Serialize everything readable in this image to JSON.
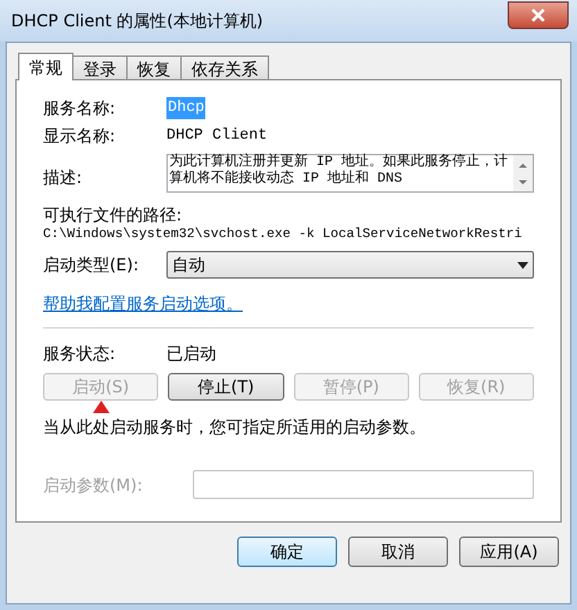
{
  "window": {
    "title": "DHCP Client 的属性(本地计算机)"
  },
  "tabs": [
    {
      "label": "常规",
      "selected": true
    },
    {
      "label": "登录",
      "selected": false
    },
    {
      "label": "恢复",
      "selected": false
    },
    {
      "label": "依存关系",
      "selected": false
    }
  ],
  "service_name": {
    "label": "服务名称:",
    "value": "Dhcp",
    "selected": true
  },
  "display_name": {
    "label": "显示名称:",
    "value": "DHCP Client"
  },
  "description": {
    "label": "描述:",
    "value": "为此计算机注册并更新 IP 地址。如果此服务停止，计算机将不能接收动态 IP 地址和 DNS"
  },
  "executable_path": {
    "label": "可执行文件的路径:",
    "value": "C:\\Windows\\system32\\svchost.exe -k LocalServiceNetworkRestri"
  },
  "startup_type": {
    "label": "启动类型(E):",
    "value": "自动"
  },
  "help_link": "帮助我配置服务启动选项。",
  "service_status": {
    "label": "服务状态:",
    "value": "已启动"
  },
  "service_buttons": [
    {
      "label": "启动(S)",
      "disabled": true
    },
    {
      "label": "停止(T)",
      "disabled": false
    },
    {
      "label": "暂停(P)",
      "disabled": true
    },
    {
      "label": "恢复(R)",
      "disabled": true
    }
  ],
  "hint": "当从此处启动服务时，您可指定所适用的启动参数。",
  "start_parameters": {
    "label": "启动参数(M):",
    "disabled": true
  },
  "dialog_buttons": [
    {
      "label": "确定",
      "default": true
    },
    {
      "label": "取消",
      "default": false
    },
    {
      "label": "应用(A)",
      "default": false
    }
  ]
}
